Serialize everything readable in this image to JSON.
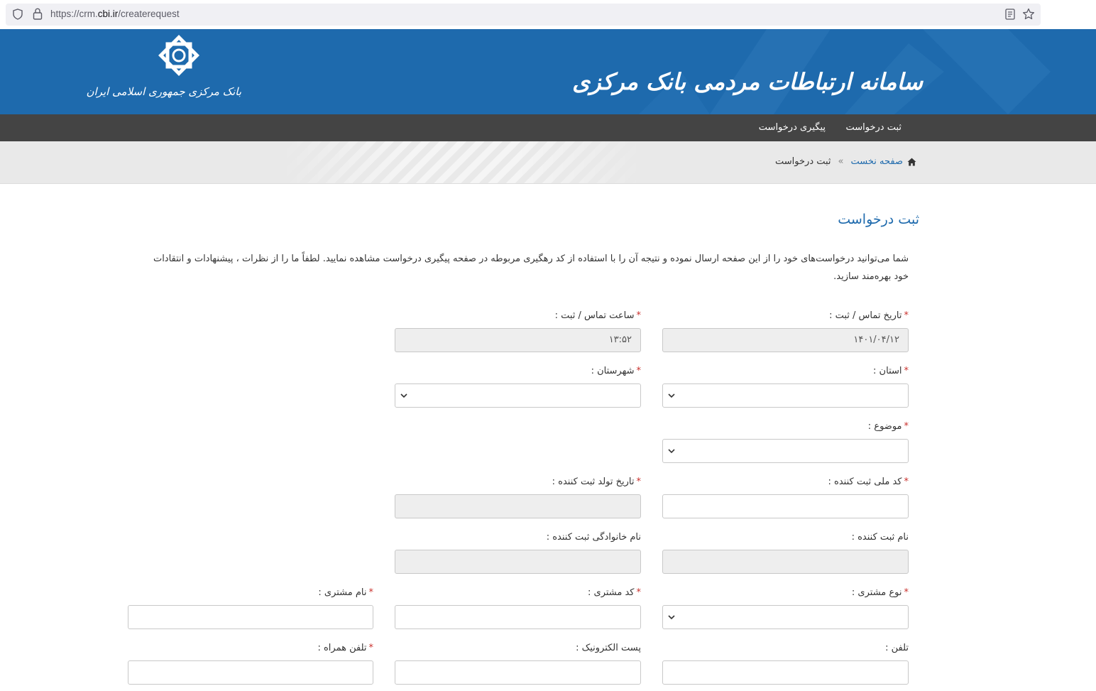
{
  "browser": {
    "url_prefix": "https://crm.",
    "url_domain": "cbi.ir",
    "url_path": "/createrequest"
  },
  "header": {
    "site_title": "سامانه ارتباطات مردمی بانک مرکزی",
    "bank_name": "بانک مرکزی جمهوری اسلامی ایران",
    "brand_color": "#1e6aad"
  },
  "nav": {
    "items": [
      "ثبت درخواست",
      "پیگیری درخواست"
    ]
  },
  "breadcrumb": {
    "home": "صفحه نخست",
    "separator": "»",
    "current": "ثبت درخواست"
  },
  "page": {
    "title": "ثبت درخواست",
    "intro": "شما می‌توانید درخواست‌های خود را از این صفحه ارسال نموده و نتیجه آن را با استفاده از کد رهگیری مربوطه در صفحه پیگیری درخواست مشاهده نمایید. لطفاً ما را از نظرات ، پیشنهادات و انتقادات خود بهره‌مند سازید."
  },
  "form": {
    "contact_date": {
      "label": "تاریخ تماس / ثبت :",
      "value": "۱۴۰۱/۰۴/۱۲",
      "required": true
    },
    "contact_time": {
      "label": "ساعت تماس / ثبت :",
      "value": "۱۳:۵۲",
      "required": true
    },
    "province": {
      "label": "استان :",
      "value": "",
      "required": true
    },
    "city": {
      "label": "شهرستان :",
      "value": "",
      "required": true
    },
    "subject": {
      "label": "موضوع :",
      "value": "",
      "required": true
    },
    "national_code": {
      "label": "کد ملی ثبت کننده :",
      "value": "",
      "required": true
    },
    "birth_date": {
      "label": "تاریخ تولد ثبت کننده :",
      "value": "",
      "required": true
    },
    "first_name": {
      "label": "نام ثبت کننده :",
      "value": "",
      "required": false
    },
    "last_name": {
      "label": "نام خانوادگی ثبت کننده :",
      "value": "",
      "required": false
    },
    "customer_type": {
      "label": "نوع مشتری :",
      "value": "",
      "required": true
    },
    "customer_code": {
      "label": "کد مشتری :",
      "value": "",
      "required": true
    },
    "customer_name": {
      "label": "نام مشتری :",
      "value": "",
      "required": true
    },
    "phone": {
      "label": "تلفن :",
      "value": "",
      "required": false
    },
    "email": {
      "label": "پست الکترونیک :",
      "value": "",
      "required": false
    },
    "mobile": {
      "label": "تلفن همراه :",
      "value": "",
      "required": true
    },
    "required_mark": "*"
  }
}
